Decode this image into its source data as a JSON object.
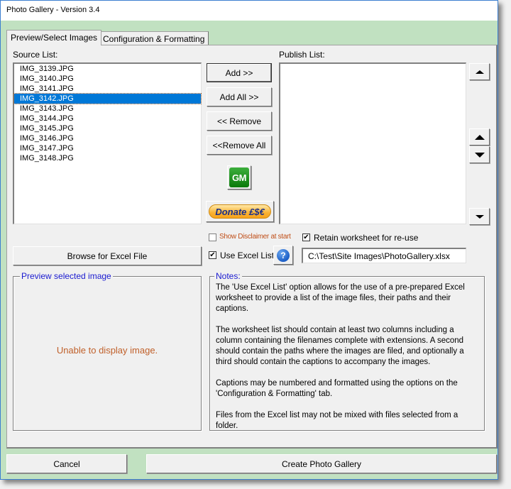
{
  "window": {
    "title": "Photo Gallery - Version 3.4"
  },
  "tabs": [
    {
      "label": "Preview/Select Images",
      "active": true
    },
    {
      "label": "Configuration & Formatting",
      "active": false
    }
  ],
  "source_list": {
    "label": "Source List:",
    "items": [
      "IMG_3139.JPG",
      "IMG_3140.JPG",
      "IMG_3141.JPG",
      "IMG_3142.JPG",
      "IMG_3143.JPG",
      "IMG_3144.JPG",
      "IMG_3145.JPG",
      "IMG_3146.JPG",
      "IMG_3147.JPG",
      "IMG_3148.JPG"
    ],
    "selected_index": 3
  },
  "publish_list": {
    "label": "Publish List:",
    "items": []
  },
  "transfer_buttons": {
    "add": "Add >>",
    "add_all": "Add All >>",
    "remove": "<< Remove",
    "remove_all": "<<Remove All"
  },
  "gm_button": {
    "label": "GM",
    "icon": "gm-logo-icon"
  },
  "donate_button": {
    "label": "Donate £$€",
    "icon": "donate-icon"
  },
  "order_buttons": {
    "top": "move-to-top-icon",
    "up": "move-up-icon",
    "down": "move-down-icon",
    "bottom": "move-to-bottom-icon"
  },
  "options": {
    "show_disclaimer": {
      "label": "Show Disclaimer at start",
      "checked": false,
      "color": "#c0501a"
    },
    "retain_worksheet": {
      "label": "Retain worksheet for re-use",
      "checked": true
    },
    "use_excel_list": {
      "label": "Use Excel List",
      "checked": true
    },
    "check_mark": "✔"
  },
  "help_button": {
    "label": "?",
    "icon": "help-icon"
  },
  "browse_button": {
    "label": "Browse for Excel File"
  },
  "excel_path": {
    "value": "C:\\Test\\Site Images\\PhotoGallery.xlsx"
  },
  "preview": {
    "caption": "Preview selected image",
    "message": "Unable to display image."
  },
  "notes": {
    "caption": "Notes:",
    "paragraphs": [
      "The 'Use Excel List' option allows for the use of a pre-prepared Excel worksheet to provide a list of the image files, their paths and their captions.",
      "The worksheet list should contain at least two columns including a column containing the filenames complete with extensions. A second should contain the paths where the images are filed, and optionally a third should contain the captions to accompany the images.",
      "Captions may be numbered and formatted using the options on the 'Configuration & Formatting' tab.",
      "Files from the Excel list may not be mixed with files selected from a folder."
    ]
  },
  "footer": {
    "cancel": "Cancel",
    "create": "Create Photo Gallery"
  },
  "colors": {
    "window_border": "#3c7fd0",
    "window_background": "#c1e1c1",
    "selection": "#0078d7",
    "frame_caption": "#1a1ad0",
    "preview_message": "#c0602a"
  }
}
